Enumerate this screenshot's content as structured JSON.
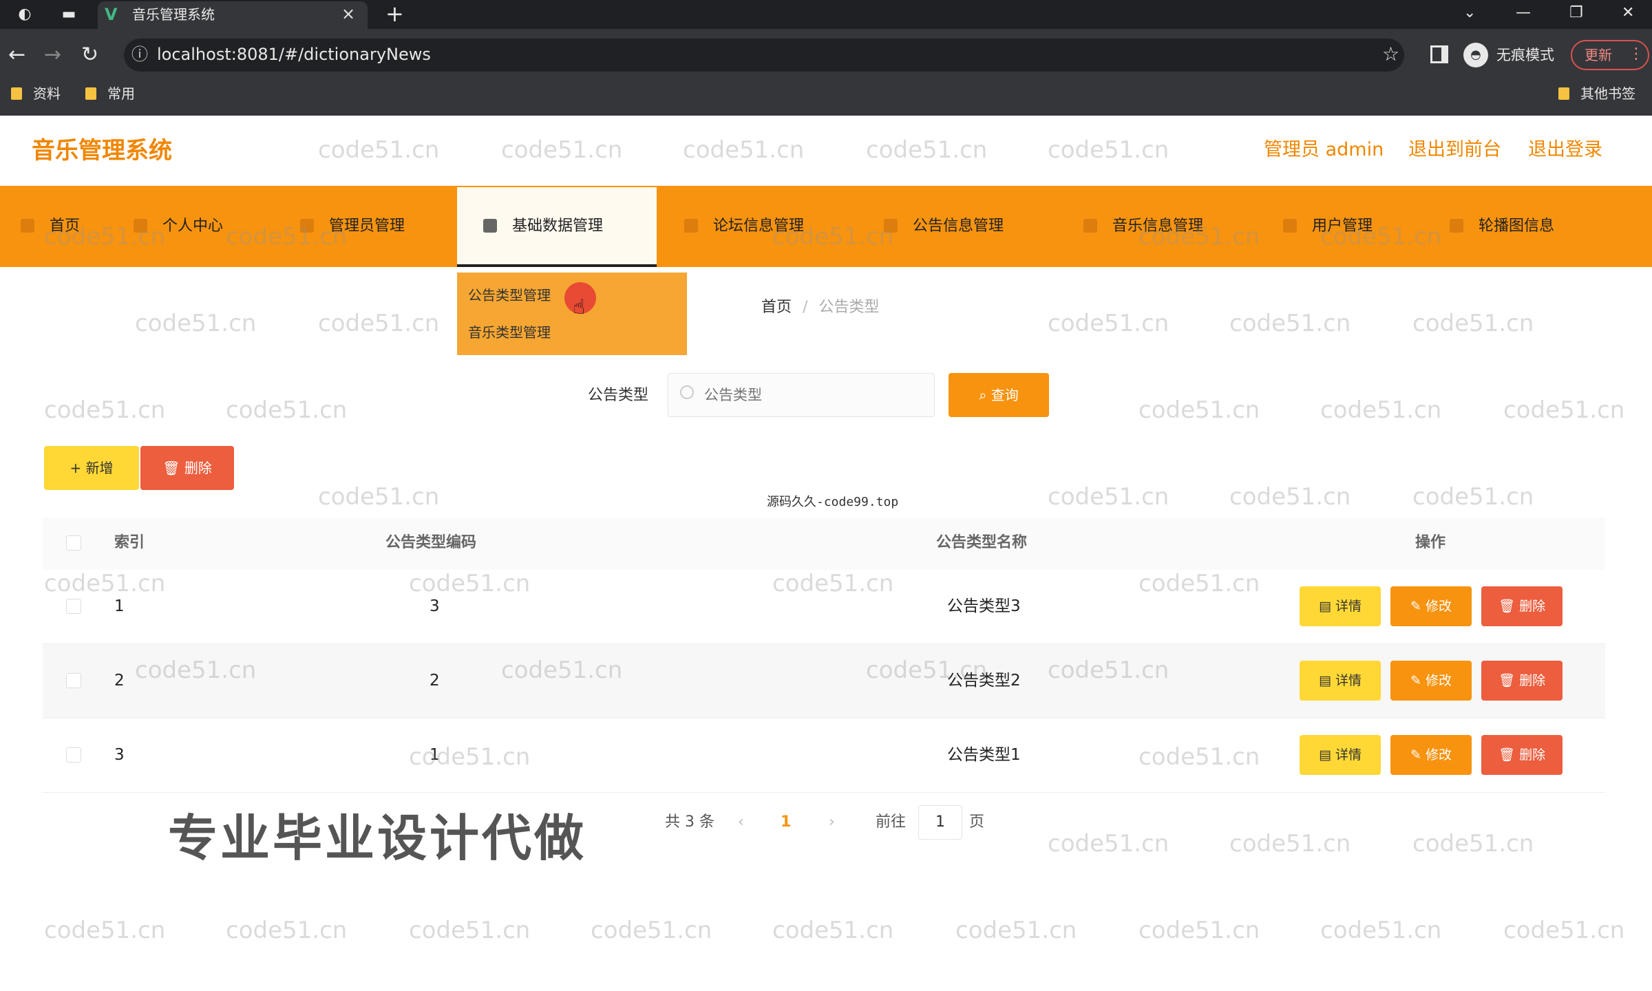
{
  "browser": {
    "tab_title": "音乐管理系统",
    "url": "localhost:8081/#/dictionaryNews",
    "incognito_label": "无痕模式",
    "update_label": "更新",
    "bookmarks": [
      "资料",
      "常用"
    ],
    "other_bookmarks": "其他书签"
  },
  "header": {
    "app_title": "音乐管理系统",
    "admin_label": "管理员 admin",
    "back_to_front": "退出到前台",
    "logout": "退出登录",
    "accent_color": "#f08600"
  },
  "nav": {
    "items": [
      {
        "label": "首页"
      },
      {
        "label": "个人中心"
      },
      {
        "label": "管理员管理"
      },
      {
        "label": "基础数据管理"
      },
      {
        "label": "论坛信息管理"
      },
      {
        "label": "公告信息管理"
      },
      {
        "label": "音乐信息管理"
      },
      {
        "label": "用户管理"
      },
      {
        "label": "轮播图信息"
      }
    ],
    "active_index": 3,
    "dropdown": [
      "公告类型管理",
      "音乐类型管理"
    ],
    "bar_color": "#f7930f"
  },
  "breadcrumb": {
    "home": "首页",
    "sep": "/",
    "current": "公告类型"
  },
  "search": {
    "label": "公告类型",
    "placeholder": "公告类型",
    "query_button": "查询"
  },
  "toolbar": {
    "add_label": "新增",
    "delete_label": "删除"
  },
  "center_watermark": "源码久久-code99.top",
  "table": {
    "columns": [
      "索引",
      "公告类型编码",
      "公告类型名称",
      "操作"
    ],
    "rows": [
      {
        "index": "1",
        "code": "3",
        "name": "公告类型3"
      },
      {
        "index": "2",
        "code": "2",
        "name": "公告类型2"
      },
      {
        "index": "3",
        "code": "1",
        "name": "公告类型1"
      }
    ],
    "row_actions": {
      "detail": "详情",
      "edit": "修改",
      "delete": "删除"
    }
  },
  "pagination": {
    "total": "共 3 条",
    "prev": "‹",
    "current_page": "1",
    "next": "›",
    "goto_label": "前往",
    "goto_value": "1",
    "page_unit": "页"
  },
  "promo_text": "专业毕业设计代做",
  "watermark_text": "code51.cn"
}
